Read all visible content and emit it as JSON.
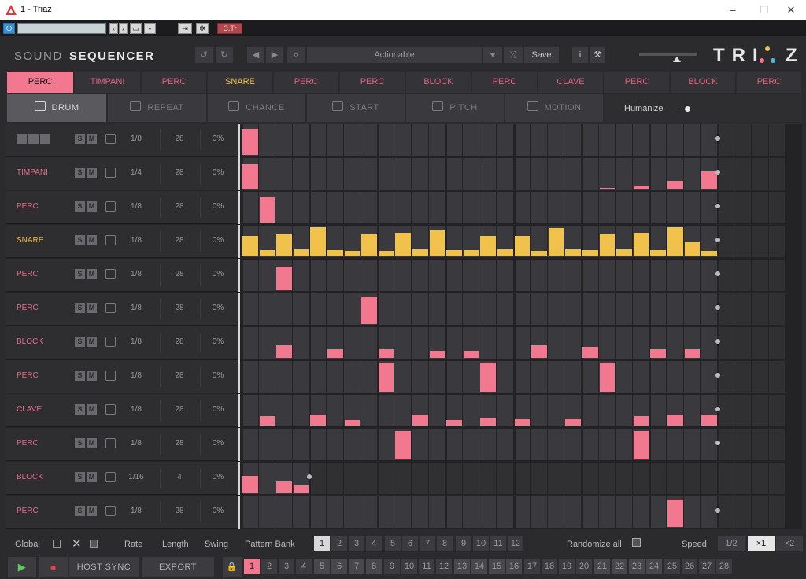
{
  "window": {
    "title": "1 - Triaz",
    "minimize": "–",
    "maximize": "☐",
    "close": "✕"
  },
  "host": {
    "preset_value": "",
    "cmd_label": "C.Tr"
  },
  "header": {
    "brand_left": "SOUND",
    "brand_right": "SEQUENCER",
    "preset_name": "Actionable",
    "save": "Save",
    "logo": "TRIAZ"
  },
  "tabs": [
    "PERC",
    "TIMPANI",
    "PERC",
    "SNARE",
    "PERC",
    "PERC",
    "BLOCK",
    "PERC",
    "CLAVE",
    "PERC",
    "BLOCK",
    "PERC"
  ],
  "modes": [
    "DRUM",
    "REPEAT",
    "CHANCE",
    "START",
    "PITCH",
    "MOTION"
  ],
  "humanize": {
    "label": "Humanize",
    "value": 0.1
  },
  "tracks": [
    {
      "name": "",
      "rate": "1/8",
      "length": "28",
      "swing": "0%",
      "color": "pink",
      "bars": [
        {
          "s": 0,
          "h": 0.9
        }
      ]
    },
    {
      "name": "TIMPANI",
      "rate": "1/4",
      "length": "28",
      "swing": "0%",
      "color": "pink",
      "bars": [
        {
          "s": 0,
          "h": 0.85
        },
        {
          "s": 21,
          "h": 0.04
        },
        {
          "s": 23,
          "h": 0.1
        },
        {
          "s": 25,
          "h": 0.28
        },
        {
          "s": 27,
          "h": 0.6
        }
      ]
    },
    {
      "name": "PERC",
      "rate": "1/8",
      "length": "28",
      "swing": "0%",
      "color": "pink",
      "bars": [
        {
          "s": 1,
          "h": 0.88
        }
      ]
    },
    {
      "name": "SNARE",
      "rate": "1/8",
      "length": "28",
      "swing": "0%",
      "color": "yellow",
      "bars": [
        {
          "s": 0,
          "h": 0.7
        },
        {
          "s": 1,
          "h": 0.22
        },
        {
          "s": 2,
          "h": 0.75
        },
        {
          "s": 3,
          "h": 0.25
        },
        {
          "s": 4,
          "h": 1
        },
        {
          "s": 5,
          "h": 0.22
        },
        {
          "s": 6,
          "h": 0.18
        },
        {
          "s": 7,
          "h": 0.75
        },
        {
          "s": 8,
          "h": 0.18
        },
        {
          "s": 9,
          "h": 0.8
        },
        {
          "s": 10,
          "h": 0.25
        },
        {
          "s": 11,
          "h": 0.88
        },
        {
          "s": 12,
          "h": 0.22
        },
        {
          "s": 13,
          "h": 0.22
        },
        {
          "s": 14,
          "h": 0.7
        },
        {
          "s": 15,
          "h": 0.25
        },
        {
          "s": 16,
          "h": 0.7
        },
        {
          "s": 17,
          "h": 0.18
        },
        {
          "s": 18,
          "h": 0.98
        },
        {
          "s": 19,
          "h": 0.25
        },
        {
          "s": 20,
          "h": 0.22
        },
        {
          "s": 21,
          "h": 0.75
        },
        {
          "s": 22,
          "h": 0.25
        },
        {
          "s": 23,
          "h": 0.8
        },
        {
          "s": 24,
          "h": 0.22
        },
        {
          "s": 25,
          "h": 1
        },
        {
          "s": 26,
          "h": 0.48
        },
        {
          "s": 27,
          "h": 0.18
        }
      ]
    },
    {
      "name": "PERC",
      "rate": "1/8",
      "length": "28",
      "swing": "0%",
      "color": "pink",
      "bars": [
        {
          "s": 2,
          "h": 0.82
        }
      ]
    },
    {
      "name": "PERC",
      "rate": "1/8",
      "length": "28",
      "swing": "0%",
      "color": "pink",
      "bars": [
        {
          "s": 7,
          "h": 0.95
        }
      ]
    },
    {
      "name": "BLOCK",
      "rate": "1/8",
      "length": "28",
      "swing": "0%",
      "color": "pink",
      "bars": [
        {
          "s": 2,
          "h": 0.42
        },
        {
          "s": 5,
          "h": 0.3
        },
        {
          "s": 8,
          "h": 0.3
        },
        {
          "s": 11,
          "h": 0.25
        },
        {
          "s": 13,
          "h": 0.25
        },
        {
          "s": 17,
          "h": 0.42
        },
        {
          "s": 20,
          "h": 0.38
        },
        {
          "s": 24,
          "h": 0.3
        },
        {
          "s": 26,
          "h": 0.3
        }
      ]
    },
    {
      "name": "PERC",
      "rate": "1/8",
      "length": "28",
      "swing": "0%",
      "color": "pink",
      "bars": [
        {
          "s": 8,
          "h": 1
        },
        {
          "s": 14,
          "h": 1
        },
        {
          "s": 21,
          "h": 1
        }
      ]
    },
    {
      "name": "CLAVE",
      "rate": "1/8",
      "length": "28",
      "swing": "0%",
      "color": "pink",
      "bars": [
        {
          "s": 1,
          "h": 0.32
        },
        {
          "s": 4,
          "h": 0.38
        },
        {
          "s": 6,
          "h": 0.2
        },
        {
          "s": 10,
          "h": 0.38
        },
        {
          "s": 12,
          "h": 0.2
        },
        {
          "s": 14,
          "h": 0.26
        },
        {
          "s": 16,
          "h": 0.24
        },
        {
          "s": 19,
          "h": 0.24
        },
        {
          "s": 23,
          "h": 0.32
        },
        {
          "s": 25,
          "h": 0.38
        },
        {
          "s": 27,
          "h": 0.38
        }
      ]
    },
    {
      "name": "PERC",
      "rate": "1/8",
      "length": "28",
      "swing": "0%",
      "color": "pink",
      "bars": [
        {
          "s": 9,
          "h": 0.98
        },
        {
          "s": 23,
          "h": 0.98
        }
      ]
    },
    {
      "name": "BLOCK",
      "rate": "1/16",
      "length": "4",
      "swing": "0%",
      "color": "pink",
      "bars": [
        {
          "s": 0,
          "h": 0.6
        },
        {
          "s": 2,
          "h": 0.4
        },
        {
          "s": 3,
          "h": 0.28
        }
      ]
    },
    {
      "name": "PERC",
      "rate": "1/8",
      "length": "28",
      "swing": "0%",
      "color": "pink",
      "bars": [
        {
          "s": 25,
          "h": 0.95
        }
      ]
    }
  ],
  "footer": {
    "global": "Global",
    "rate": "Rate",
    "length": "Length",
    "swing": "Swing",
    "pattern_bank": "Pattern Bank",
    "randomize": "Randomize all",
    "speed": "Speed",
    "speeds": [
      "1/2",
      "×1",
      "×2"
    ],
    "host_sync": "HOST SYNC",
    "export": "EXPORT"
  },
  "banks": [
    "1",
    "2",
    "3",
    "4",
    "5",
    "6",
    "7",
    "8",
    "9",
    "10",
    "11",
    "12"
  ],
  "patterns": [
    "1",
    "2",
    "3",
    "4",
    "5",
    "6",
    "7",
    "8",
    "9",
    "10",
    "11",
    "12",
    "13",
    "14",
    "15",
    "16",
    "17",
    "18",
    "19",
    "20",
    "21",
    "22",
    "23",
    "24",
    "25",
    "26",
    "27",
    "28"
  ],
  "colors": {
    "pink": "#f2788f",
    "yellow": "#f0c14b"
  }
}
